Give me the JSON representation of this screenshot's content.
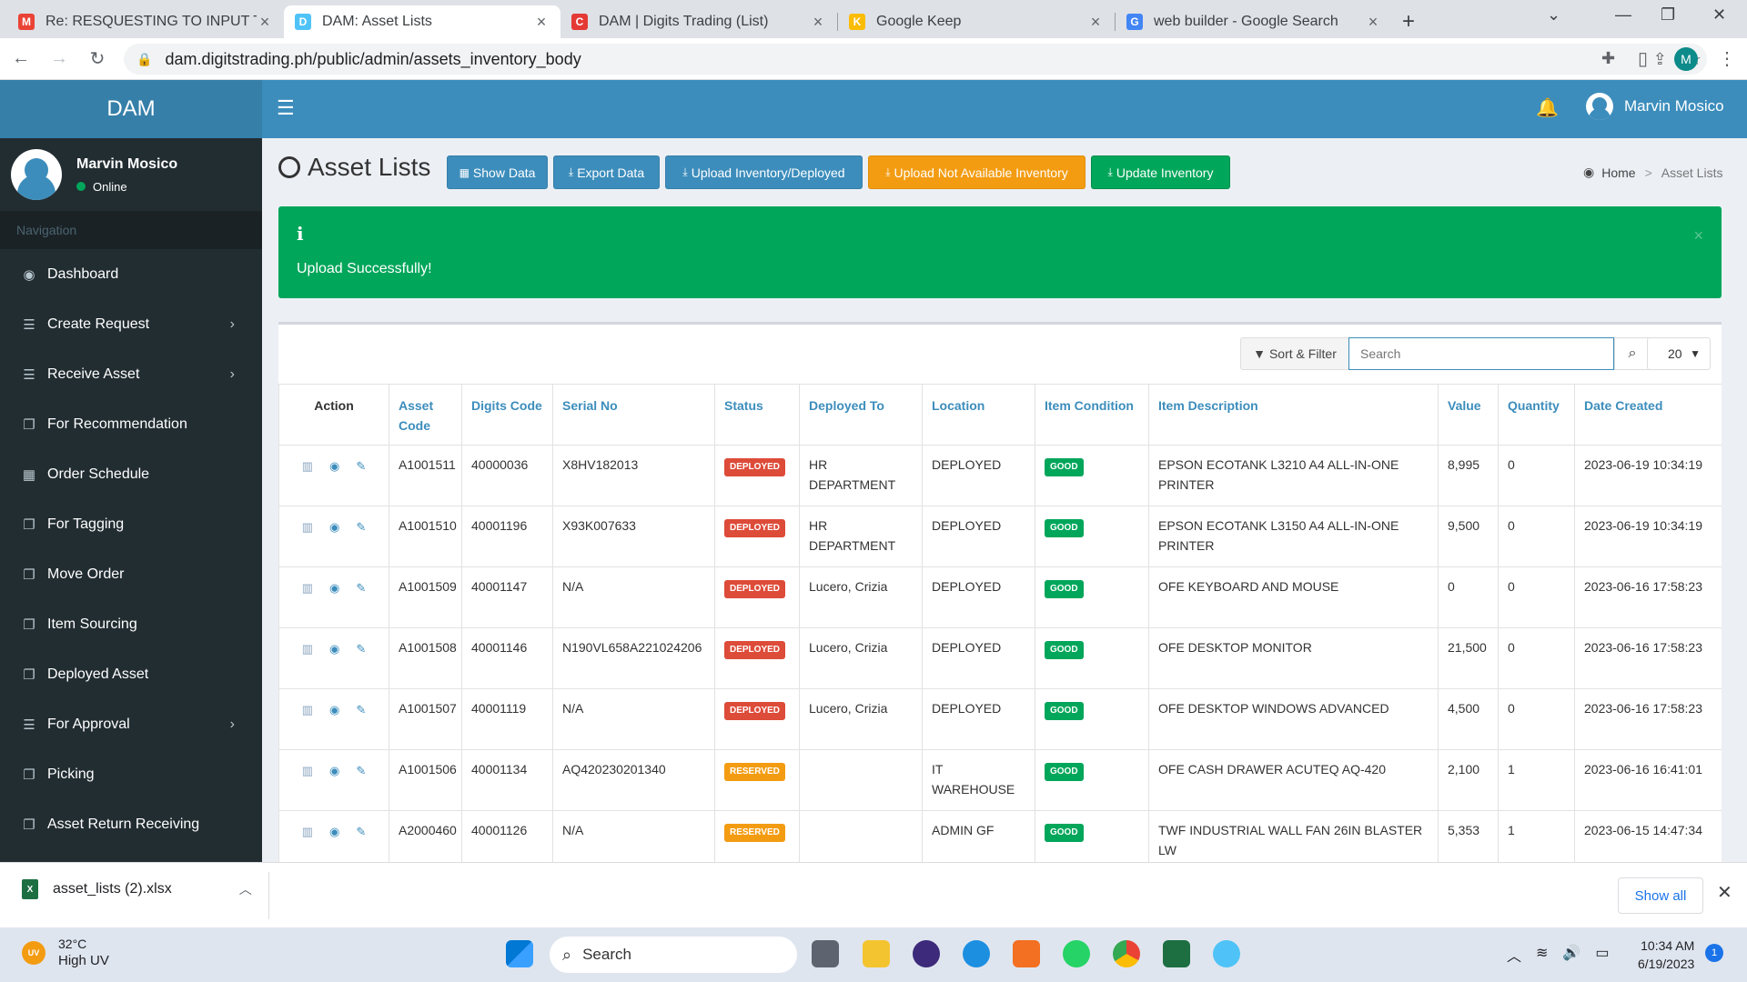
{
  "browser": {
    "tabs": [
      {
        "title": "Re: RESQUESTING TO INPUT TO DAM",
        "favicon": "M",
        "color": "#ea4335"
      },
      {
        "title": "DAM: Asset Lists",
        "favicon": "D",
        "color": "#4fc3f7"
      },
      {
        "title": "DAM | Digits Trading (List)",
        "favicon": "C",
        "color": "#e53935"
      },
      {
        "title": "Google Keep",
        "favicon": "K",
        "color": "#fbbc04"
      },
      {
        "title": "web builder - Google Search",
        "favicon": "G",
        "color": "#4285f4"
      }
    ],
    "url": "dam.digitstrading.ph/public/admin/assets_inventory_body",
    "profile_initial": "M"
  },
  "app": {
    "logo": "DAM",
    "header_user": "Marvin Mosico"
  },
  "sidebar": {
    "user_name": "Marvin Mosico",
    "user_status": "Online",
    "nav_header": "Navigation",
    "items": [
      {
        "label": "Dashboard",
        "icon": "dashboard-icon",
        "chevron": false
      },
      {
        "label": "Create Request",
        "icon": "list-icon",
        "chevron": true
      },
      {
        "label": "Receive Asset",
        "icon": "list-icon",
        "chevron": true
      },
      {
        "label": "For Recommendation",
        "icon": "copy-icon",
        "chevron": false
      },
      {
        "label": "Order Schedule",
        "icon": "calendar-icon",
        "chevron": false
      },
      {
        "label": "For Tagging",
        "icon": "copy-icon",
        "chevron": false
      },
      {
        "label": "Move Order",
        "icon": "copy-icon",
        "chevron": false
      },
      {
        "label": "Item Sourcing",
        "icon": "copy-icon",
        "chevron": false
      },
      {
        "label": "Deployed Asset",
        "icon": "copy-icon",
        "chevron": false
      },
      {
        "label": "For Approval",
        "icon": "list-icon",
        "chevron": true
      },
      {
        "label": "Picking",
        "icon": "copy-icon",
        "chevron": false
      },
      {
        "label": "Asset Return Receiving",
        "icon": "copy-icon",
        "chevron": false
      }
    ]
  },
  "content": {
    "title": "Asset Lists",
    "buttons": {
      "show_data": "Show Data",
      "export_data": "Export Data",
      "upload_inventory": "Upload Inventory/Deployed",
      "upload_not_available": "Upload Not Available Inventory",
      "update_inventory": "Update Inventory"
    },
    "breadcrumb": {
      "home": "Home",
      "current": "Asset Lists"
    },
    "alert": {
      "icon": "i",
      "message": "Upload Successfully!",
      "close": "×"
    },
    "toolbar": {
      "sort_filter": "Sort & Filter",
      "search_placeholder": "Search",
      "per_page": "20"
    },
    "table": {
      "headers": [
        "Action",
        "Asset Code",
        "Digits Code",
        "Serial No",
        "Status",
        "Deployed To",
        "Location",
        "Item Condition",
        "Item Description",
        "Value",
        "Quantity",
        "Date Created"
      ],
      "rows": [
        {
          "asset_code": "A1001511",
          "digits_code": "40000036",
          "serial": "X8HV182013",
          "status": "DEPLOYED",
          "deployed_to": "HR DEPARTMENT",
          "location": "DEPLOYED",
          "condition": "GOOD",
          "description": "EPSON ECOTANK L3210 A4 ALL-IN-ONE PRINTER",
          "value": "8,995",
          "quantity": "0",
          "date": "2023-06-19 10:34:19"
        },
        {
          "asset_code": "A1001510",
          "digits_code": "40001196",
          "serial": "X93K007633",
          "status": "DEPLOYED",
          "deployed_to": "HR DEPARTMENT",
          "location": "DEPLOYED",
          "condition": "GOOD",
          "description": "EPSON ECOTANK L3150 A4 ALL-IN-ONE PRINTER",
          "value": "9,500",
          "quantity": "0",
          "date": "2023-06-19 10:34:19"
        },
        {
          "asset_code": "A1001509",
          "digits_code": "40001147",
          "serial": "N/A",
          "status": "DEPLOYED",
          "deployed_to": "Lucero, Crizia",
          "location": "DEPLOYED",
          "condition": "GOOD",
          "description": "OFE KEYBOARD AND MOUSE",
          "value": "0",
          "quantity": "0",
          "date": "2023-06-16 17:58:23"
        },
        {
          "asset_code": "A1001508",
          "digits_code": "40001146",
          "serial": "N190VL658A221024206",
          "status": "DEPLOYED",
          "deployed_to": "Lucero, Crizia",
          "location": "DEPLOYED",
          "condition": "GOOD",
          "description": "OFE DESKTOP MONITOR",
          "value": "21,500",
          "quantity": "0",
          "date": "2023-06-16 17:58:23"
        },
        {
          "asset_code": "A1001507",
          "digits_code": "40001119",
          "serial": "N/A",
          "status": "DEPLOYED",
          "deployed_to": "Lucero, Crizia",
          "location": "DEPLOYED",
          "condition": "GOOD",
          "description": "OFE DESKTOP WINDOWS ADVANCED",
          "value": "4,500",
          "quantity": "0",
          "date": "2023-06-16 17:58:23"
        },
        {
          "asset_code": "A1001506",
          "digits_code": "40001134",
          "serial": "AQ420230201340",
          "status": "RESERVED",
          "deployed_to": "",
          "location": "IT WAREHOUSE",
          "condition": "GOOD",
          "description": "OFE CASH DRAWER ACUTEQ AQ-420",
          "value": "2,100",
          "quantity": "1",
          "date": "2023-06-16 16:41:01"
        },
        {
          "asset_code": "A2000460",
          "digits_code": "40001126",
          "serial": "N/A",
          "status": "RESERVED",
          "deployed_to": "",
          "location": "ADMIN GF",
          "condition": "GOOD",
          "description": "TWF INDUSTRIAL WALL FAN 26IN BLASTER LW",
          "value": "5,353",
          "quantity": "1",
          "date": "2023-06-15 14:47:34"
        }
      ]
    }
  },
  "downloads": {
    "file": "asset_lists (2).xlsx",
    "show_all": "Show all"
  },
  "taskbar": {
    "temperature": "32°C",
    "weather": "High UV",
    "uv_badge": "UV",
    "search": "Search",
    "time": "10:34 AM",
    "date": "6/19/2023",
    "notifications": "1"
  }
}
